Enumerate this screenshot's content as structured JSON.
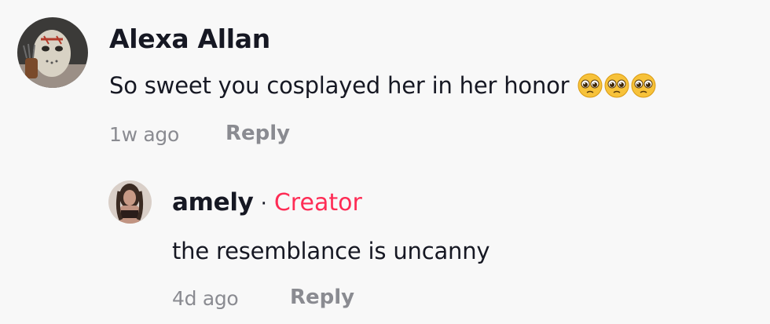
{
  "comment": {
    "author": "Alexa Allan",
    "text": "So sweet you cosplayed her in her honor",
    "emoji": [
      "pleading-face",
      "pleading-face",
      "pleading-face"
    ],
    "time": "1w ago",
    "reply_label": "Reply"
  },
  "reply": {
    "author": "amely",
    "separator": "·",
    "badge": "Creator",
    "text": "the resemblance is uncanny",
    "time": "4d ago",
    "reply_label": "Reply"
  },
  "colors": {
    "background": "#f8f8f8",
    "text": "#161823",
    "muted": "#8a8b91",
    "creator_badge": "#fe2c55"
  }
}
